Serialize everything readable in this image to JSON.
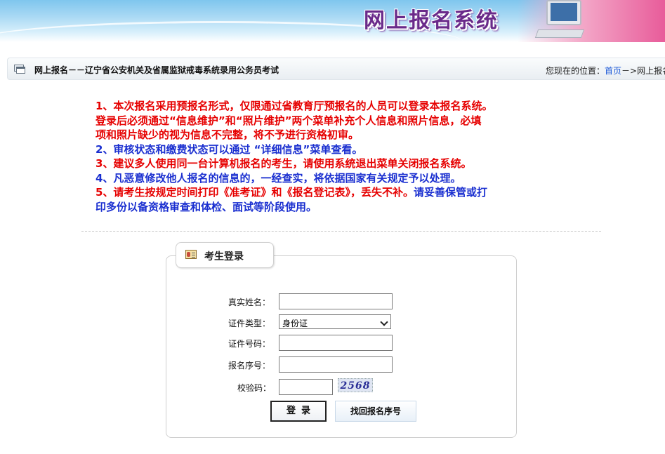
{
  "banner": {
    "title": "网上报名系统"
  },
  "nav": {
    "title": "网上报名－－辽宁省公安机关及省属监狱戒毒系统录用公务员考试",
    "location_label": "您现在的位置：",
    "home_link": "首页",
    "separator": "－>",
    "current": "网上报名"
  },
  "notices": {
    "n1_line1": "1、本次报名采用预报名形式，仅限通过省教育厅预报名的人员可以登录本报名系统。",
    "n1_line2a": "登录后必须通过“信息维护”和“照片维护”两个菜单补充个人信息和照片信息，",
    "n1_line2b": "必填",
    "n1_line3": "项和照片缺少的视为信息不完整，将不予进行资格初审。",
    "n2": "2、审核状态和缴费状态可以通过 “详细信息”菜单查看。",
    "n3": "3、建议多人使用同一台计算机报名的考生，请使用系统退出菜单关闭报名系统。",
    "n4": "4、凡恶意修改他人报名的信息的，一经查实，将依据国家有关规定予以处理。",
    "n5_line1a": "5、请考生按规定时间打印《准考证》和《报名登记表》，丢失不补。",
    "n5_line1b": "请妥善保管或打",
    "n5_line2": "印多份以备资格审查和体检、面试等阶段使用。"
  },
  "login": {
    "title": "考生登录",
    "name_label": "真实姓名：",
    "id_type_label": "证件类型：",
    "id_type_value": "身份证",
    "id_number_label": "证件号码：",
    "reg_no_label": "报名序号：",
    "captcha_label": "校验码：",
    "captcha_text": "2568",
    "login_button": "登录",
    "find_button": "找回报名序号"
  },
  "colors": {
    "notice_red": "#e60000",
    "notice_blue": "#1a2fd0",
    "link": "#1f5bd8"
  }
}
